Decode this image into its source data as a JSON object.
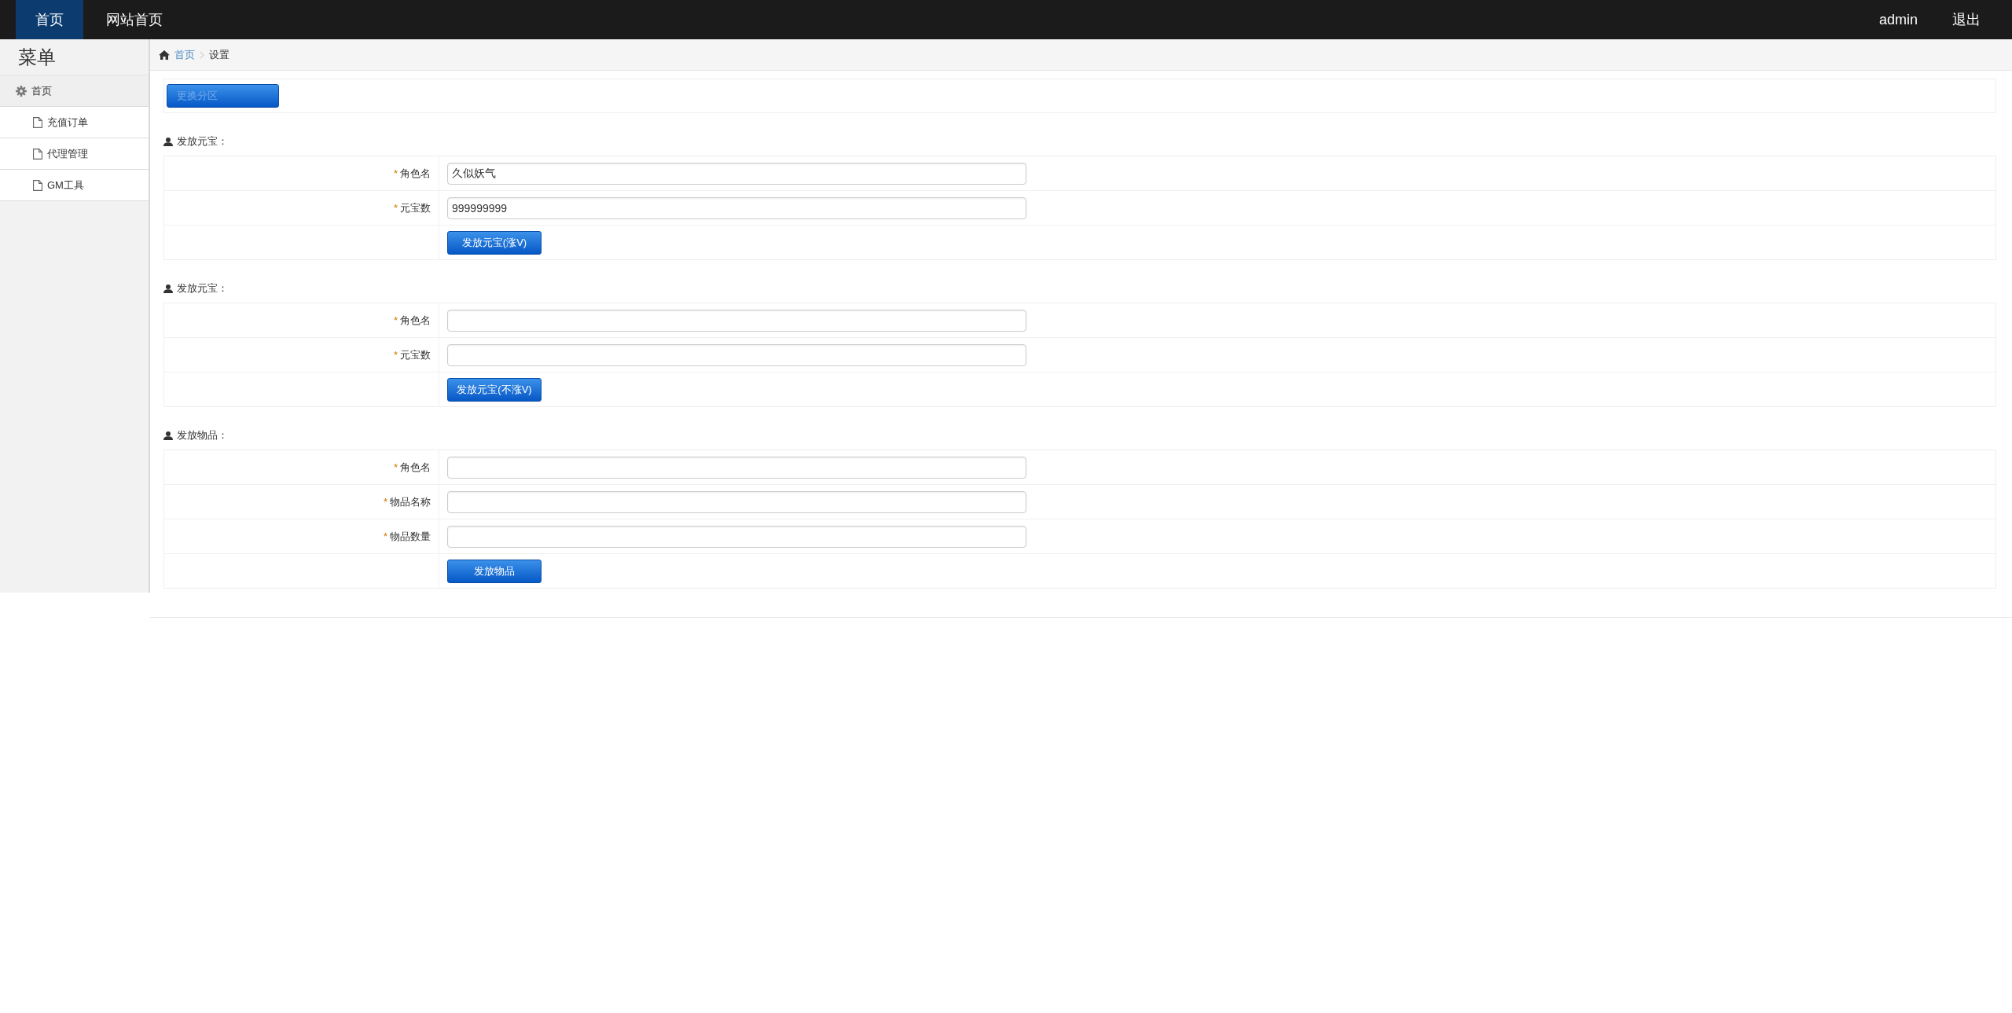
{
  "top_nav": {
    "items": [
      {
        "label": "首页",
        "selected": true
      },
      {
        "label": "网站首页",
        "selected": false
      }
    ],
    "user_name": "admin",
    "logout": "退出"
  },
  "sidebar": {
    "title": "菜单",
    "items": [
      {
        "label": "首页",
        "children": [
          {
            "label": "充值订单"
          },
          {
            "label": "代理管理"
          },
          {
            "label": "GM工具"
          }
        ]
      }
    ]
  },
  "breadcrumb": [
    {
      "label": "首页",
      "kind": "link"
    },
    {
      "label": "设置",
      "kind": "current"
    }
  ],
  "partition_button": {
    "label": "更换分区",
    "disabled": true
  },
  "forms": [
    {
      "title": "发放元宝：",
      "fields": [
        {
          "mark": "*",
          "label": "角色名",
          "value": "久似妖气"
        },
        {
          "mark": "*",
          "label": "元宝数",
          "value": "999999999"
        }
      ],
      "submit": "发放元宝(涨V)"
    },
    {
      "title": "发放元宝：",
      "fields": [
        {
          "mark": "*",
          "label": "角色名"
        },
        {
          "mark": "*",
          "label": "元宝数"
        }
      ],
      "submit": "发放元宝(不涨V)"
    },
    {
      "title": "发放物品：",
      "fields": [
        {
          "mark": "*",
          "label": "角色名"
        },
        {
          "mark": "*",
          "label": "物品名称"
        },
        {
          "mark": "*",
          "label": "物品数量"
        }
      ],
      "submit": "发放物品"
    }
  ]
}
